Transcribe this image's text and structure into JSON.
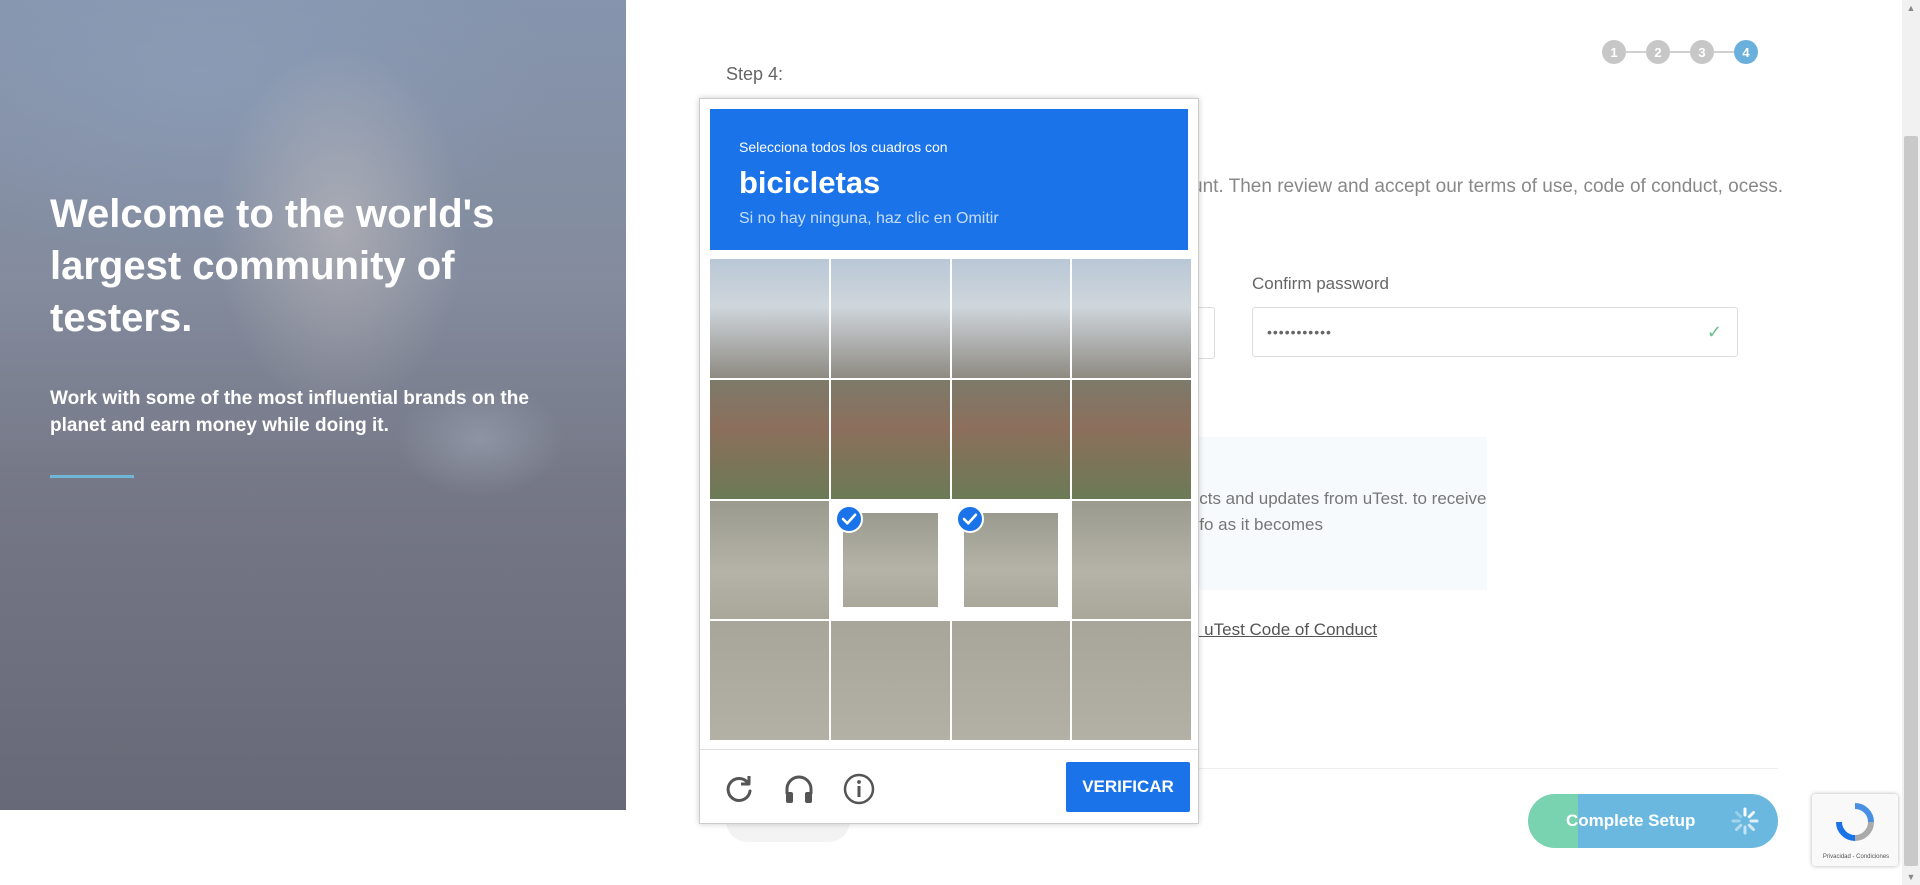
{
  "hero": {
    "title": "Welcome to the world's largest community of testers.",
    "subtitle": "Work with some of the most influential brands on the planet and earn money while doing it."
  },
  "steps": {
    "items": [
      "1",
      "2",
      "3",
      "4"
    ],
    "active": "4"
  },
  "form": {
    "step_label": "Step 4:",
    "intro": "unt. Then review and accept our terms of use, code of conduct, ocess.",
    "confirm_password_label": "Confirm password",
    "confirm_password_value": "•••••••••••",
    "info_text": "jects and updates from uTest. to receive info as it becomes",
    "code_of_conduct_link": "e uTest Code of Conduct",
    "complete_button": "Complete Setup"
  },
  "captcha": {
    "instruction": "Selecciona todos los cuadros con",
    "target": "bicicletas",
    "hint": "Si no hay ninguna, haz clic en Omitir",
    "verify_button": "VERIFICAR",
    "icons": [
      "reload-icon",
      "headphones-icon",
      "info-icon"
    ],
    "selected_tiles": [
      9,
      10
    ]
  },
  "recaptcha_badge": {
    "text": "Privacidad - Condiciones"
  },
  "colors": {
    "captcha_blue": "#1a73e8",
    "step_active": "#6ab0dc",
    "complete_green": "#79d2b0",
    "complete_blue": "#6ab8e0"
  }
}
